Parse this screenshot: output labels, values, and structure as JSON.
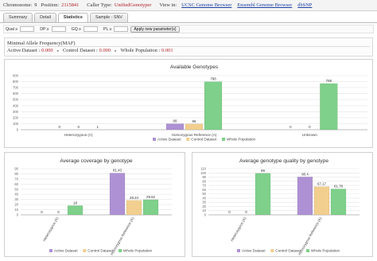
{
  "header": {
    "chromosome_label": "Chromosome:",
    "chromosome_value": "9",
    "position_label": "Position:",
    "position_value": "2115841",
    "caller_label": "Caller Type:",
    "caller_value": "UnifiedGenotyper",
    "view_label": "View in:",
    "links": [
      "UCSC Genome Browser",
      "Ensembl Genome Browser",
      "dbSNP"
    ]
  },
  "tabs": [
    "Summary",
    "Detail",
    "Statistics",
    "Sample - SNV"
  ],
  "active_tab": "Statistics",
  "filters": {
    "fields": [
      {
        "label": "Qual ≥",
        "value": ""
      },
      {
        "label": "DP ≥",
        "value": ""
      },
      {
        "label": "GQ ≥",
        "value": ""
      },
      {
        "label": "PL ≥",
        "value": ""
      }
    ],
    "apply_label": "Apply new parameter(s)"
  },
  "maf": {
    "title": "Minimal Allele Frequency(MAF)",
    "items": [
      {
        "label": "Active Dataset :",
        "value": "0.000"
      },
      {
        "label": "Control Dataset :",
        "value": "0.000"
      },
      {
        "label": "Whole Population :",
        "value": "0.001"
      }
    ]
  },
  "colors": {
    "active": "#ae91d4",
    "control": "#f2cf8e",
    "whole": "#7ed08a"
  },
  "chart_data": [
    {
      "type": "bar",
      "title": "Available Genotypes",
      "categories": [
        "Heterozygous (A)",
        "Homozygous Reference (A)",
        "Unknown"
      ],
      "series": [
        {
          "name": "Active Dataset",
          "values": [
            0,
            99,
            0
          ]
        },
        {
          "name": "Control Dataset",
          "values": [
            0,
            95,
            0
          ]
        },
        {
          "name": "Whole Population",
          "values": [
            1,
            798,
            768
          ]
        }
      ],
      "value_labels": [
        [
          "0",
          "99",
          "0"
        ],
        [
          "0",
          "95",
          "0"
        ],
        [
          "1",
          "798",
          "768"
        ]
      ],
      "ylim": [
        0,
        900
      ],
      "yticks": [
        0,
        100,
        200,
        300,
        400,
        500,
        600,
        700,
        800,
        900
      ],
      "grid": true,
      "legend": "bottom",
      "tick_rotation": 0
    },
    {
      "type": "bar",
      "title": "Average coverage by genotype",
      "categories": [
        "Heterozygous (A)",
        "Homozygous Reference (A)"
      ],
      "series": [
        {
          "name": "Active Dataset",
          "values": [
            0,
            81.43
          ]
        },
        {
          "name": "Control Dataset",
          "values": [
            0,
            28.24
          ]
        },
        {
          "name": "Whole Population",
          "values": [
            18,
            29.62
          ]
        }
      ],
      "value_labels": [
        [
          "0",
          "81.43"
        ],
        [
          "0",
          "28.24"
        ],
        [
          "18",
          "29.62"
        ]
      ],
      "ylim": [
        0,
        90
      ],
      "yticks": [
        0,
        10,
        20,
        30,
        40,
        50,
        60,
        70,
        80,
        90
      ],
      "grid": true,
      "legend": "bottom",
      "tick_rotation": -60
    },
    {
      "type": "bar",
      "title": "Average genotype quality by genotype",
      "categories": [
        "Heterozygous (A)",
        "Homozygous Reference (A)"
      ],
      "series": [
        {
          "name": "Active Dataset",
          "values": [
            0,
            90.4
          ]
        },
        {
          "name": "Control Dataset",
          "values": [
            0,
            67.17
          ]
        },
        {
          "name": "Whole Population",
          "values": [
            99,
            61.78
          ]
        }
      ],
      "value_labels": [
        [
          "0",
          "90.4"
        ],
        [
          "0",
          "67.17"
        ],
        [
          "99",
          "61.78"
        ]
      ],
      "ylim": [
        0,
        110
      ],
      "yticks": [
        0,
        10,
        20,
        30,
        40,
        50,
        60,
        70,
        80,
        90,
        100,
        110
      ],
      "grid": true,
      "legend": "bottom",
      "tick_rotation": -60
    }
  ]
}
